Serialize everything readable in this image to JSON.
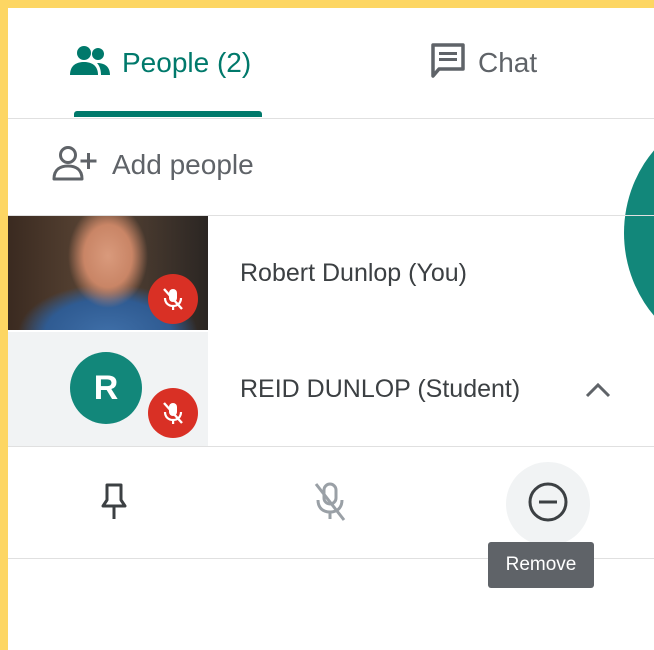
{
  "tabs": {
    "people_label": "People (2)",
    "chat_label": "Chat",
    "people_icon": "people-icon",
    "chat_icon": "chat-icon"
  },
  "add_people": {
    "label": "Add people",
    "icon": "person-add-icon"
  },
  "participants": [
    {
      "name": "Robert Dunlop (You)",
      "thumbnail": "video",
      "muted": true
    },
    {
      "name": "REID DUNLOP (Student)",
      "avatar_letter": "R",
      "muted": true,
      "expanded": true
    }
  ],
  "actions": {
    "pin_icon": "pin-icon",
    "mute_icon": "mic-off-icon",
    "remove_icon": "remove-circle-icon"
  },
  "tooltip": {
    "text": "Remove"
  },
  "colors": {
    "accent": "#00796b",
    "avatar": "#12877a",
    "muted_badge": "#d93025",
    "frame": "#fdd663"
  }
}
